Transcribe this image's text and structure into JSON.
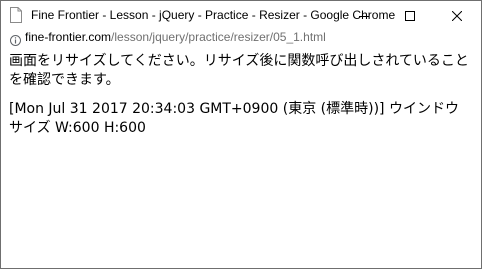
{
  "window": {
    "title": "Fine Frontier - Lesson - jQuery - Practice - Resizer - Google Chrome",
    "app_icon": "document-icon",
    "controls": {
      "minimize_icon": "minimize-icon",
      "maximize_icon": "maximize-icon",
      "close_icon": "close-icon"
    }
  },
  "address": {
    "info_icon": "info-icon",
    "host": "fine-frontier.com",
    "path": "/lesson/jquery/practice/resizer/05_1.html"
  },
  "content": {
    "instruction": "画面をリサイズしてください。リサイズ後に関数呼び出しされていることを確認できます。",
    "log": "[Mon Jul 31 2017 20:34:03 GMT+0900 (東京 (標準時))] ウインドウサイズ W:600 H:600"
  },
  "colors": {
    "border": "#6f6f6f",
    "url_path": "#707070",
    "text": "#000000"
  }
}
